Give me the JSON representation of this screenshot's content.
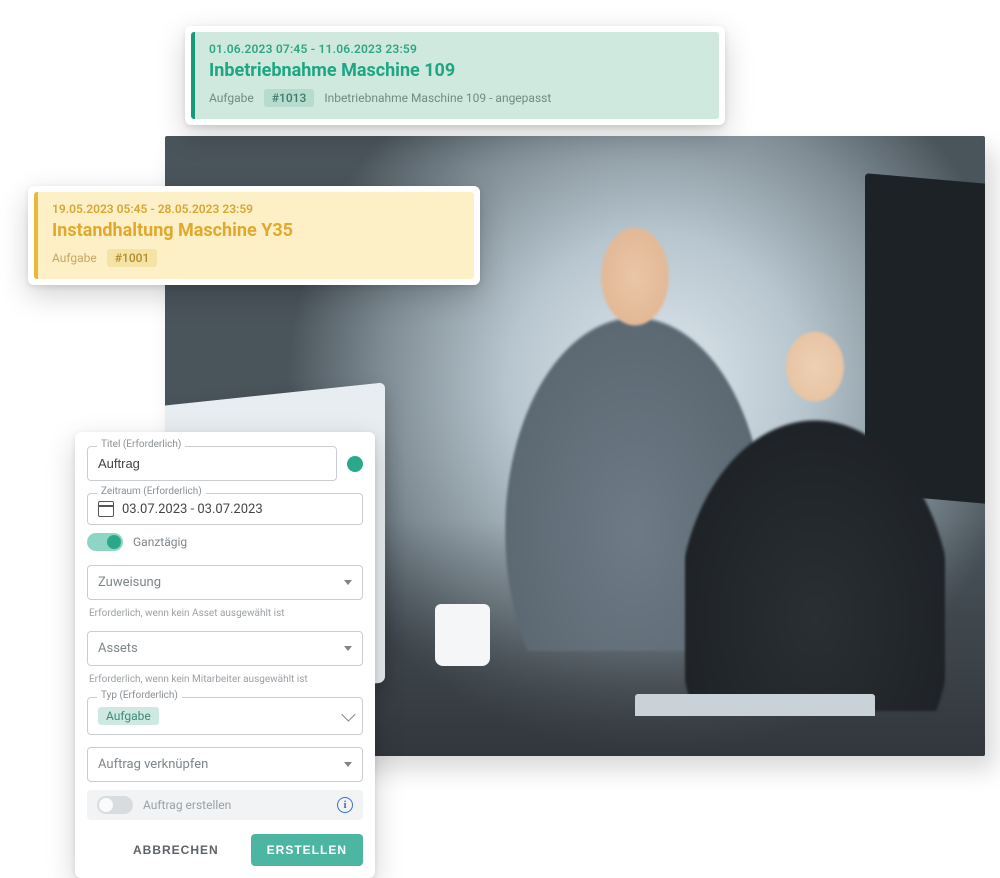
{
  "task1": {
    "date_range": "01.06.2023 07:45 - 11.06.2023 23:59",
    "title": "Inbetriebnahme Maschine 109",
    "meta_label": "Aufgabe",
    "id_badge": "#1013",
    "description": "Inbetriebnahme Maschine 109 - angepasst"
  },
  "task2": {
    "date_range": "19.05.2023 05:45 - 28.05.2023 23:59",
    "title": "Instandhaltung Maschine Y35",
    "meta_label": "Aufgabe",
    "id_badge": "#1001"
  },
  "form": {
    "title_label": "Titel (Erforderlich)",
    "title_value": "Auftrag",
    "date_label": "Zeitraum (Erforderlich)",
    "date_value": "03.07.2023 - 03.07.2023",
    "allday_label": "Ganztägig",
    "assign_placeholder": "Zuweisung",
    "assign_helper": "Erforderlich, wenn kein Asset ausgewählt ist",
    "assets_placeholder": "Assets",
    "assets_helper": "Erforderlich, wenn kein Mitarbeiter ausgewählt ist",
    "type_label": "Typ (Erforderlich)",
    "type_value": "Aufgabe",
    "link_placeholder": "Auftrag verknüpfen",
    "create_order_label": "Auftrag erstellen",
    "cancel": "ABBRECHEN",
    "submit": "ERSTELLEN"
  },
  "colors": {
    "accent": "#2aa88a"
  }
}
